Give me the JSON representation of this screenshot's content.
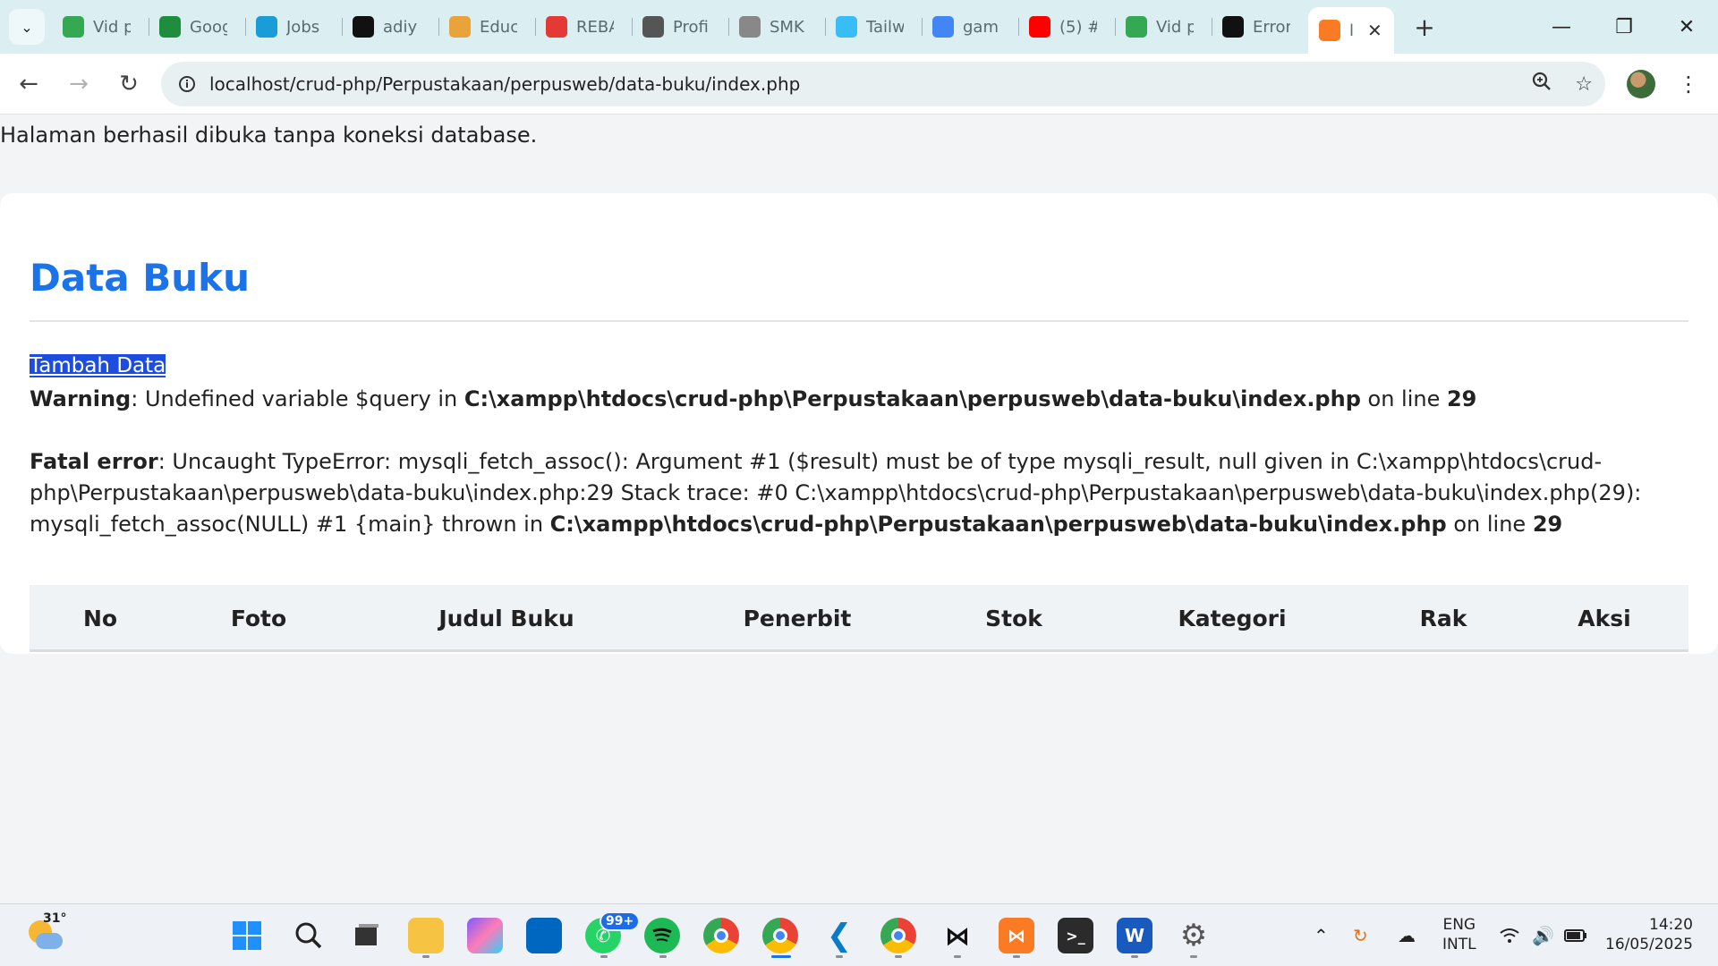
{
  "browser": {
    "tabs": [
      {
        "title": "Vid p",
        "favicon": "google-drive-icon",
        "color": "#34a853"
      },
      {
        "title": "Goog",
        "favicon": "google-classroom-icon",
        "color": "#1e8e3e"
      },
      {
        "title": "Jobs",
        "favicon": "jobstreet-icon",
        "color": "#1a9cd8"
      },
      {
        "title": "adiy",
        "favicon": "github-icon",
        "color": "#111111"
      },
      {
        "title": "Educ",
        "favicon": "education-icon",
        "color": "#e8a33a"
      },
      {
        "title": "REBA",
        "favicon": "youtube-record-icon",
        "color": "#e53935"
      },
      {
        "title": "Profi",
        "favicon": "globe-icon",
        "color": "#555555"
      },
      {
        "title": "SMK",
        "favicon": "school-logo-icon",
        "color": "#888888"
      },
      {
        "title": "Tailw",
        "favicon": "tailwind-icon",
        "color": "#38bdf8"
      },
      {
        "title": "gam",
        "favicon": "google-icon",
        "color": "#4285f4"
      },
      {
        "title": "(5) #",
        "favicon": "youtube-icon",
        "color": "#ff0000"
      },
      {
        "title": "Vid p",
        "favicon": "google-drive-icon",
        "color": "#34a853"
      },
      {
        "title": "Error",
        "favicon": "chatgpt-icon",
        "color": "#111111"
      }
    ],
    "active_tab": {
      "title": "l",
      "favicon": "xampp-icon",
      "color": "#fb7a24"
    },
    "url": "localhost/crud-php/Perpustakaan/perpusweb/data-buku/index.php"
  },
  "page": {
    "notice": "Halaman berhasil dibuka tanpa koneksi database.",
    "heading": "Data Buku",
    "add_link": "Tambah Data",
    "warning": {
      "label": "Warning",
      "text1": ": Undefined variable $query in ",
      "path": "C:\\xampp\\htdocs\\crud-php\\Perpustakaan\\perpusweb\\data-buku\\index.php",
      "text2": " on line ",
      "line": "29"
    },
    "fatal": {
      "label": "Fatal error",
      "text1": ": Uncaught TypeError: mysqli_fetch_assoc(): Argument #1 ($result) must be of type mysqli_result, null given in C:\\xampp\\htdocs\\crud-php\\Perpustakaan\\perpusweb\\data-buku\\index.php:29 Stack trace: #0 C:\\xampp\\htdocs\\crud-php\\Perpustakaan\\perpusweb\\data-buku\\index.php(29): mysqli_fetch_assoc(NULL) #1 {main} thrown in ",
      "path": "C:\\xampp\\htdocs\\crud-php\\Perpustakaan\\perpusweb\\data-buku\\index.php",
      "text2": " on line ",
      "line": "29"
    },
    "table_headers": [
      "No",
      "Foto",
      "Judul Buku",
      "Penerbit",
      "Stok",
      "Kategori",
      "Rak",
      "Aksi"
    ]
  },
  "taskbar": {
    "weather_temp": "31°",
    "whatsapp_badge": "99+",
    "language": "ENG",
    "layout": "INTL",
    "time": "14:20",
    "date": "16/05/2025"
  }
}
